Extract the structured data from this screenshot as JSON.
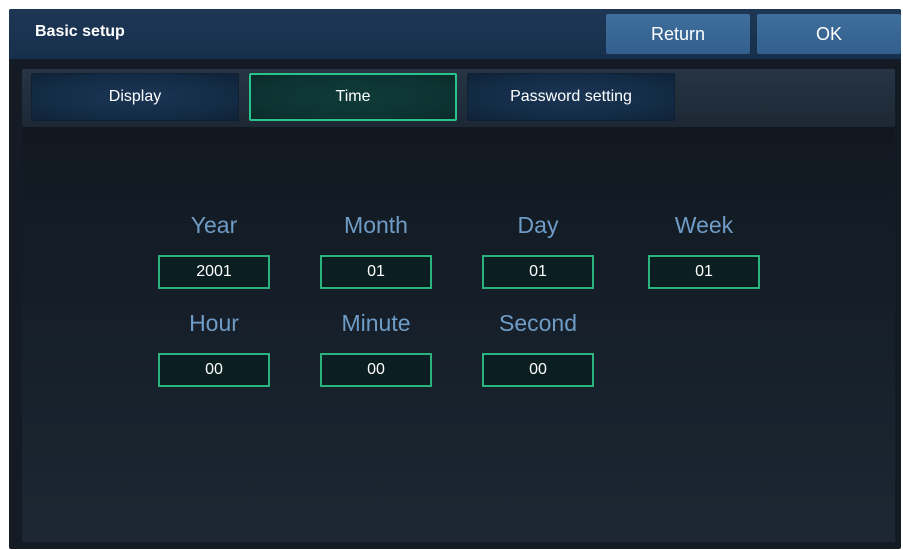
{
  "window": {
    "title": "Basic setup"
  },
  "toolbar": {
    "return_label": "Return",
    "ok_label": "OK"
  },
  "tabs": [
    {
      "label": "Display",
      "active": false
    },
    {
      "label": "Time",
      "active": true
    },
    {
      "label": "Password setting",
      "active": false
    }
  ],
  "fields": {
    "year": {
      "label": "Year",
      "value": "2001"
    },
    "month": {
      "label": "Month",
      "value": "01"
    },
    "day": {
      "label": "Day",
      "value": "01"
    },
    "week": {
      "label": "Week",
      "value": "01"
    },
    "hour": {
      "label": "Hour",
      "value": "00"
    },
    "minute": {
      "label": "Minute",
      "value": "00"
    },
    "second": {
      "label": "Second",
      "value": "00"
    }
  },
  "colors": {
    "accent_green": "#2bb37e",
    "label_blue": "#6f9cc6",
    "button_blue": "#3f6f9d",
    "background": "#141b24"
  }
}
